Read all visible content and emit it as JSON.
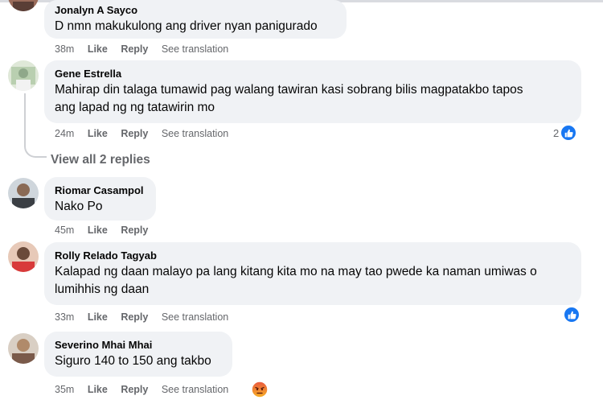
{
  "comments": [
    {
      "name": "Jonalyn A Sayco",
      "text": "D nmn makukulong ang driver nyan panigurado",
      "time": "38m",
      "like": "Like",
      "reply": "Reply",
      "see_translation": "See translation"
    },
    {
      "name": "Gene Estrella",
      "text_line1": "Mahirap din talaga tumawid pag walang tawiran kasi sobrang bilis magpatakbo tapos",
      "text_line2": "ang lapad ng ng tatawirin mo",
      "time": "24m",
      "like": "Like",
      "reply": "Reply",
      "see_translation": "See translation",
      "reaction_count": "2",
      "reaction_icon": "like-icon"
    },
    {
      "name": "Riomar Casampol",
      "text": "Nako Po",
      "time": "45m",
      "like": "Like",
      "reply": "Reply"
    },
    {
      "name": "Rolly Relado Tagyab",
      "text_line1": "Kalapad ng daan malayo pa lang kitang kita mo na may tao pwede ka naman umiwas o",
      "text_line2": "lumihhis ng daan",
      "time": "33m",
      "like": "Like",
      "reply": "Reply",
      "see_translation": "See translation",
      "reaction_icon": "like-icon"
    },
    {
      "name": "Severino Mhai Mhai",
      "text": "Siguro 140 to 150 ang takbo",
      "time": "35m",
      "like": "Like",
      "reply": "Reply",
      "see_translation": "See translation",
      "reaction_icon": "angry-icon"
    }
  ],
  "view_replies": "View all 2 replies",
  "colors": {
    "accent": "#1877f2",
    "bubble": "#f0f2f5",
    "muted": "#65676b",
    "angry": "#e9573f"
  }
}
